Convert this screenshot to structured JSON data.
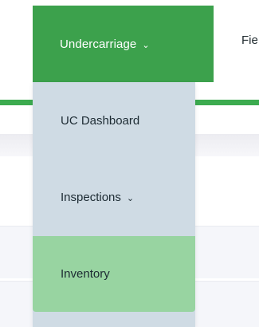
{
  "nav": {
    "active_tab": {
      "label": "Undercarriage",
      "icon": "chevron-down-icon",
      "chevron": "⌄"
    },
    "next_tab": {
      "label": "Fie"
    },
    "underline_color": "#3cab4f",
    "active_bg_color": "#3ca14c"
  },
  "dropdown": {
    "bg_color": "#cfdbe4",
    "highlight_color": "#98d4a1",
    "items": [
      {
        "label": "UC Dashboard"
      },
      {
        "label": "Inspections",
        "icon": "chevron-down-icon",
        "chevron": "⌄"
      },
      {
        "label": "Inventory",
        "highlighted": true
      }
    ]
  }
}
